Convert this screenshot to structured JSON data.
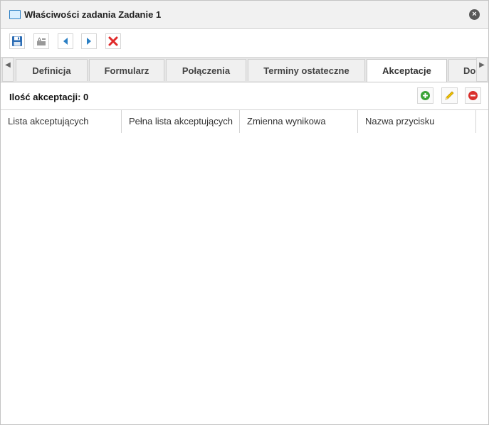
{
  "dialog": {
    "title": "Właściwości zadania Zadanie 1",
    "close_label": "×"
  },
  "toolbar": {
    "buttons": [
      {
        "name": "save",
        "icon": "floppy-disk-icon"
      },
      {
        "name": "properties",
        "icon": "text-lines-icon"
      },
      {
        "name": "previous",
        "icon": "arrow-left-icon"
      },
      {
        "name": "next",
        "icon": "arrow-right-icon"
      },
      {
        "name": "delete",
        "icon": "red-x-icon"
      }
    ]
  },
  "tabs": {
    "scroll_left": "◀",
    "scroll_right": "▶",
    "items": [
      {
        "label": "Definicja"
      },
      {
        "label": "Formularz"
      },
      {
        "label": "Połączenia"
      },
      {
        "label": "Terminy ostateczne"
      },
      {
        "label": "Akceptacje",
        "active": true
      },
      {
        "label": "Do"
      }
    ]
  },
  "acceptances": {
    "count_label": "Ilość akceptacji: 0",
    "actions": [
      {
        "name": "add",
        "icon": "green-plus-icon",
        "color": "#3aa336"
      },
      {
        "name": "edit",
        "icon": "pencil-icon",
        "color": "#e6b800"
      },
      {
        "name": "remove",
        "icon": "red-minus-icon",
        "color": "#d9302c"
      }
    ]
  },
  "grid": {
    "columns": [
      {
        "label": "Lista akceptujących"
      },
      {
        "label": "Pełna lista akceptujących"
      },
      {
        "label": "Zmienna wynikowa"
      },
      {
        "label": "Nazwa przycisku"
      }
    ],
    "rows": []
  },
  "colors": {
    "titlebar_bg": "#f1f1f1",
    "tabbar_bg": "#e6e6e6",
    "border": "#d4d4d4",
    "accent_blue": "#2a7fc4"
  }
}
